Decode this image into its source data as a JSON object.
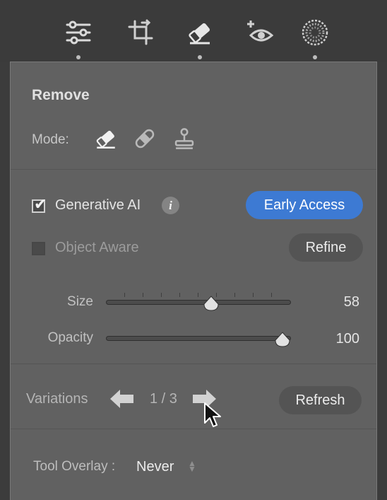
{
  "toolbar": {
    "tools": [
      {
        "icon": "sliders-icon",
        "active": true
      },
      {
        "icon": "crop-icon",
        "active": false
      },
      {
        "icon": "eraser-icon",
        "active": true
      },
      {
        "icon": "red-eye-icon",
        "active": false
      },
      {
        "icon": "masking-icon",
        "active": true
      }
    ]
  },
  "panel": {
    "title": "Remove",
    "mode": {
      "label": "Mode:",
      "options": [
        "eraser-icon",
        "bandage-icon",
        "clone-stamp-icon"
      ]
    },
    "generative_ai": {
      "label": "Generative AI",
      "checked": true,
      "info_glyph": "i",
      "badge_label": "Early Access"
    },
    "object_aware": {
      "label": "Object Aware",
      "checked": false,
      "refine_label": "Refine"
    },
    "sliders": [
      {
        "label": "Size",
        "value": "58",
        "position": 0.57
      },
      {
        "label": "Opacity",
        "value": "100",
        "position": 1.0
      }
    ],
    "variations": {
      "label": "Variations",
      "count": "1 / 3",
      "refresh_label": "Refresh"
    },
    "tool_overlay": {
      "label": "Tool Overlay :",
      "value": "Never"
    }
  },
  "colors": {
    "panel_bg": "#616161",
    "accent_blue": "#3d7ad3",
    "toolbar_bg": "#3b3b3b"
  }
}
